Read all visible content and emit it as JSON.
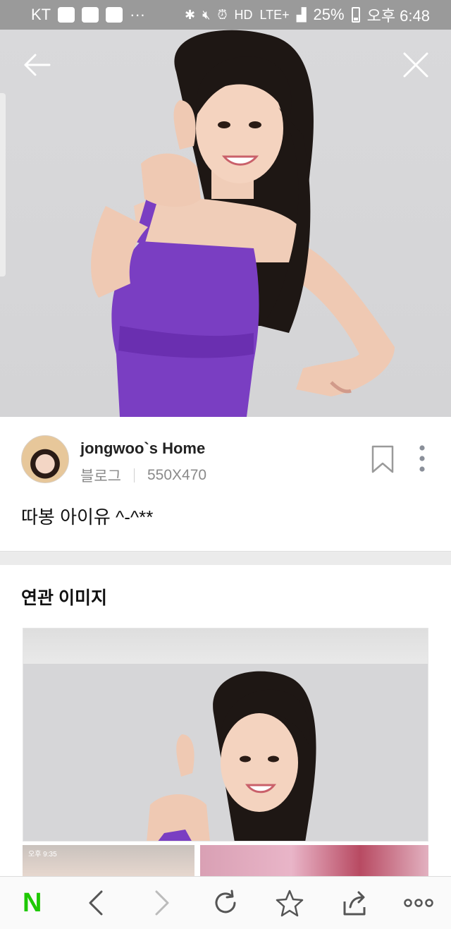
{
  "status_bar": {
    "carrier": "KT",
    "network": "LTE+",
    "battery": "25%",
    "time": "오후 6:48",
    "icons": [
      "notification-app-icon",
      "gallery-icon",
      "app-icon",
      "more-dots",
      "bluetooth-icon",
      "mute-icon",
      "alarm-icon",
      "hd-icon",
      "signal-icon",
      "battery-icon"
    ]
  },
  "viewer": {
    "back_icon": "arrow-left-icon",
    "close_icon": "close-icon"
  },
  "source": {
    "name": "jongwoo`s Home",
    "type": "블로그",
    "dimensions": "550X470",
    "caption": "따봉 아이유 ^-^**"
  },
  "related": {
    "title": "연관 이미지",
    "thumb_mini_time": "오후 9:35"
  },
  "bottom_nav": {
    "logo": "N",
    "items": [
      "back-icon",
      "forward-icon",
      "refresh-icon",
      "star-icon",
      "share-icon",
      "more-icon"
    ]
  },
  "colors": {
    "status_bar": "#9a9a9a",
    "naver_green": "#1ec800",
    "dress_purple": "#7a3ec2"
  }
}
